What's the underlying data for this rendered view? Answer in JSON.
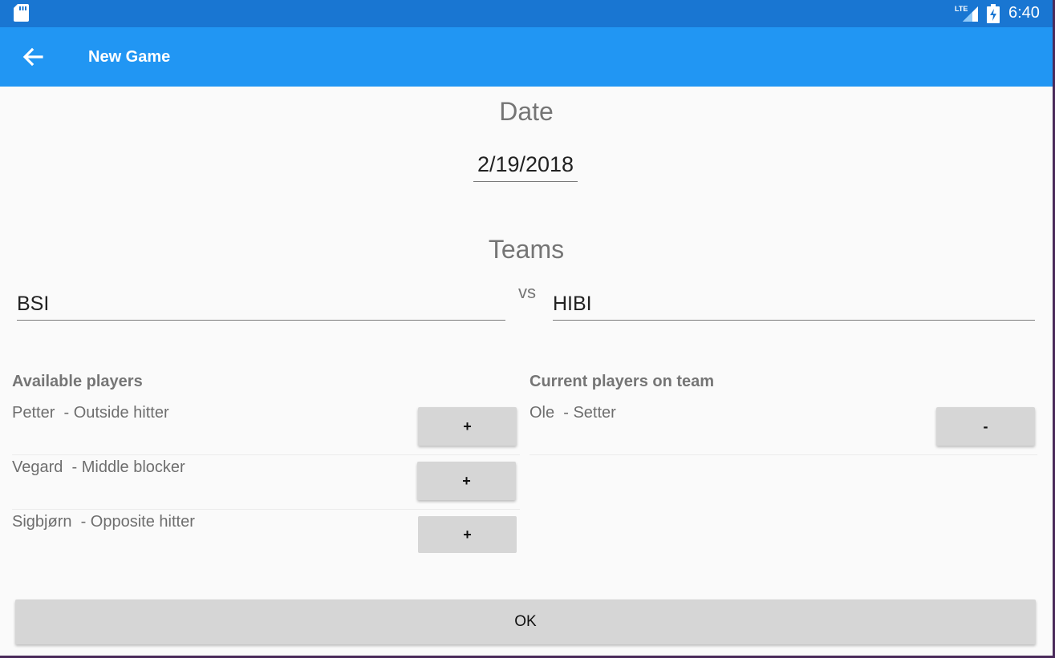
{
  "status_bar": {
    "time": "6:40",
    "network_label": "LTE",
    "icons": [
      "sd-card-icon",
      "lte-signal-icon",
      "battery-charging-icon"
    ]
  },
  "app_bar": {
    "title": "New Game",
    "back_icon": "arrow-back-icon"
  },
  "date": {
    "heading": "Date",
    "value": "2/19/2018"
  },
  "teams": {
    "heading": "Teams",
    "home": "BSI",
    "vs": "vs",
    "away": "HIBI"
  },
  "available_players": {
    "heading": "Available players",
    "items": [
      {
        "name": "Petter",
        "position": "Outside hitter",
        "text": "Petter  - Outside hitter",
        "action": "+"
      },
      {
        "name": "Vegard",
        "position": "Middle blocker",
        "text": "Vegard  - Middle blocker",
        "action": "+"
      },
      {
        "name": "Sigbjørn",
        "position": "Opposite hitter",
        "text": "Sigbjørn  - Opposite hitter",
        "action": "+"
      }
    ]
  },
  "current_players": {
    "heading": "Current players on team",
    "items": [
      {
        "name": "Ole",
        "position": "Setter",
        "text": "Ole  - Setter",
        "action": "-"
      }
    ]
  },
  "ok_label": "OK",
  "colors": {
    "status_bar": "#1976d2",
    "app_bar": "#2196f3",
    "background": "#fafafa",
    "button": "#d6d6d6",
    "secondary_text": "#757575"
  }
}
